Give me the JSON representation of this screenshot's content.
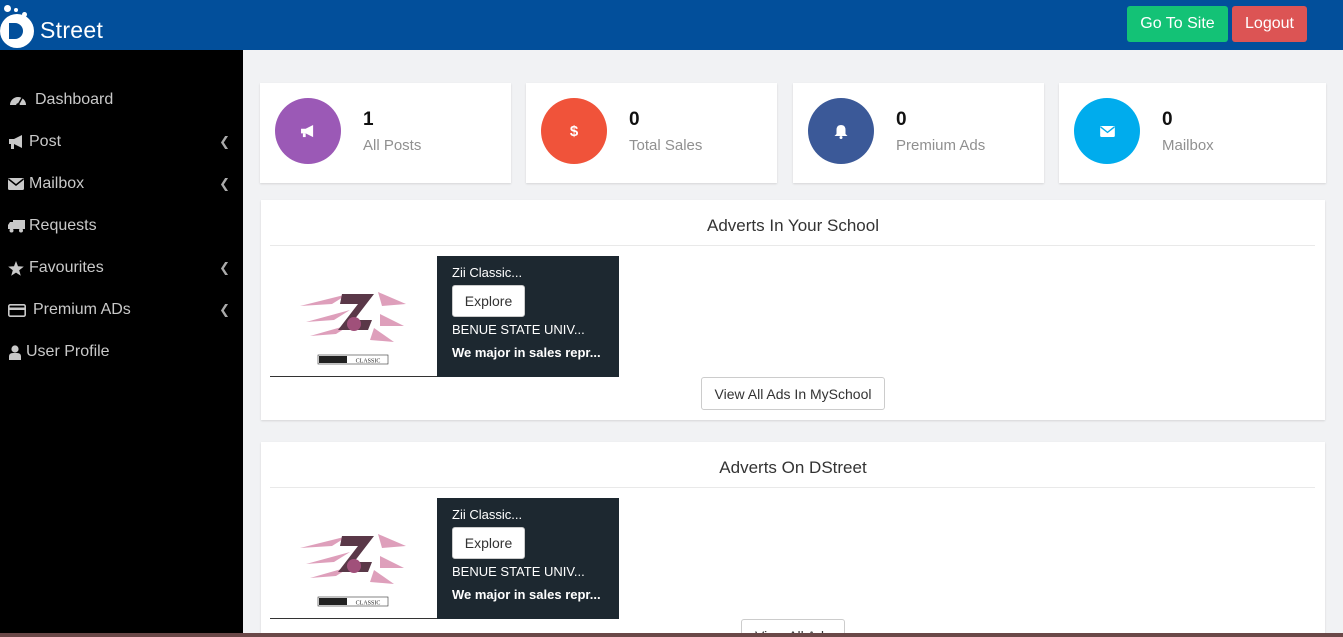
{
  "header": {
    "logo_text": "Street",
    "go_to_site": "Go To Site",
    "logout": "Logout"
  },
  "sidebar": {
    "items": [
      {
        "label": "Dashboard",
        "icon": "tachometer-icon",
        "has_submenu": false
      },
      {
        "label": "Post",
        "icon": "bullhorn-icon",
        "has_submenu": true
      },
      {
        "label": "Mailbox",
        "icon": "envelope-icon",
        "has_submenu": true
      },
      {
        "label": "Requests",
        "icon": "truck-icon",
        "has_submenu": false
      },
      {
        "label": "Favourites",
        "icon": "star-icon",
        "has_submenu": true
      },
      {
        "label": "Premium ADs",
        "icon": "credit-card-icon",
        "has_submenu": true
      },
      {
        "label": "User Profile",
        "icon": "user-icon",
        "has_submenu": false
      }
    ]
  },
  "stats": [
    {
      "value": "1",
      "label": "All Posts",
      "icon": "bullhorn-icon",
      "color": "#9b59b6"
    },
    {
      "value": "0",
      "label": "Total Sales",
      "icon": "dollar-icon",
      "color": "#f0533a"
    },
    {
      "value": "0",
      "label": "Premium Ads",
      "icon": "bell-icon",
      "color": "#3b5998"
    },
    {
      "value": "0",
      "label": "Mailbox",
      "icon": "envelope-icon",
      "color": "#00aced"
    }
  ],
  "school_adverts": {
    "title": "Adverts In Your School",
    "ads": [
      {
        "title": "Zii Classic...",
        "explore": "Explore",
        "school": "BENUE STATE UNIV...",
        "description": "We major in sales repr...",
        "logo_text": "CLASSIC"
      }
    ],
    "view_all": "View All Ads In MySchool"
  },
  "dstreet_adverts": {
    "title": "Adverts On DStreet",
    "ads": [
      {
        "title": "Zii Classic...",
        "explore": "Explore",
        "school": "BENUE STATE UNIV...",
        "description": "We major in sales repr...",
        "logo_text": "CLASSIC"
      }
    ],
    "view_all": "View All Ads"
  }
}
